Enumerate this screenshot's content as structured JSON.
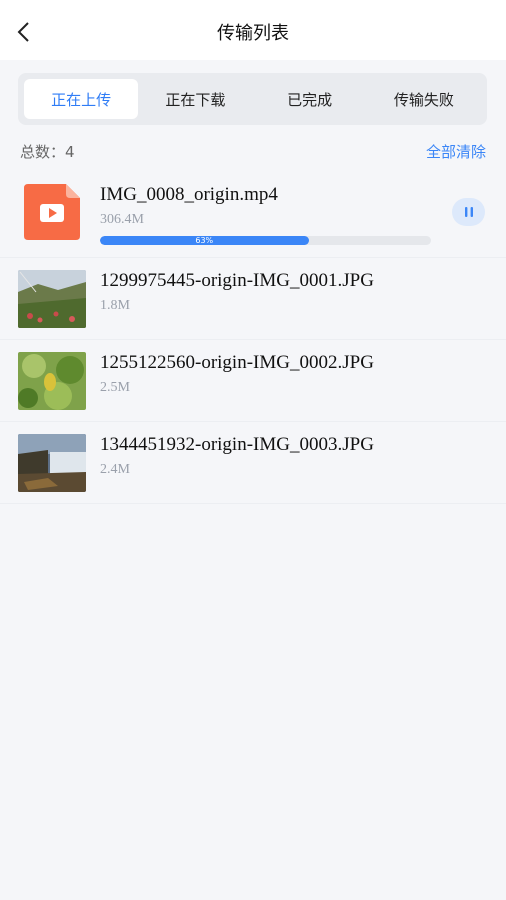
{
  "header": {
    "title": "传输列表"
  },
  "tabs": [
    {
      "label": "正在上传",
      "active": true
    },
    {
      "label": "正在下载",
      "active": false
    },
    {
      "label": "已完成",
      "active": false
    },
    {
      "label": "传输失败",
      "active": false
    }
  ],
  "summary": {
    "total_label": "总数：4",
    "clear_label": "全部清除"
  },
  "uploads": [
    {
      "name": "IMG_0008_origin.mp4",
      "size": "306.4M",
      "type": "video",
      "progress": 0.63,
      "progress_label": "63%"
    },
    {
      "name": "1299975445-origin-IMG_0001.JPG",
      "size": "1.8M",
      "type": "image"
    },
    {
      "name": "1255122560-origin-IMG_0002.JPG",
      "size": "2.5M",
      "type": "image"
    },
    {
      "name": "1344451932-origin-IMG_0003.JPG",
      "size": "2.4M",
      "type": "image"
    }
  ],
  "colors": {
    "accent": "#3b86f7",
    "video_icon": "#f76b45",
    "background": "#f5f6f9"
  },
  "icons": {
    "back": "chevron-left-icon",
    "pause": "pause-icon",
    "video_file": "video-file-icon"
  }
}
